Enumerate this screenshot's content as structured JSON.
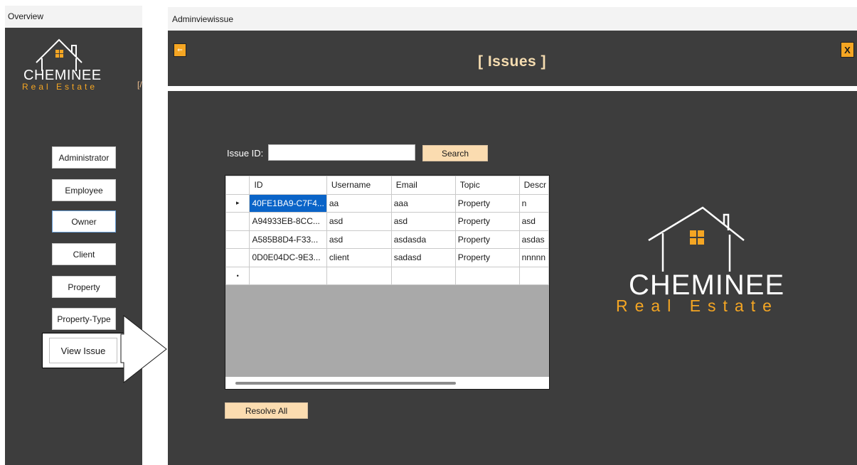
{
  "left_window": {
    "title": "Overview",
    "logo": {
      "brand": "CHEMINEE",
      "tagline": "Real Estate"
    },
    "clipped_text": "[/",
    "nav": [
      {
        "label": "Administrator"
      },
      {
        "label": "Employee"
      },
      {
        "label": "Owner"
      },
      {
        "label": "Client"
      },
      {
        "label": "Property"
      },
      {
        "label": "Property-Type"
      },
      {
        "label": "View Issue"
      }
    ]
  },
  "right_window": {
    "title": "Adminviewissue",
    "header": {
      "back_label": "⇐",
      "close_label": "X",
      "page_title": "[ Issues ]"
    },
    "search": {
      "label": "Issue ID:",
      "value": "",
      "button": "Search"
    },
    "grid": {
      "columns": [
        "ID",
        "Username",
        "Email",
        "Topic",
        "Descr"
      ],
      "rows": [
        [
          "40FE1BA9-C7F4...",
          "aa",
          "aaa",
          "Property",
          "n"
        ],
        [
          "A94933EB-8CC...",
          "asd",
          "asd",
          "Property",
          "asd"
        ],
        [
          "A585B8D4-F33...",
          "asd",
          "asdasda",
          "Property",
          "asdas"
        ],
        [
          "0D0E04DC-9E3...",
          "client",
          "sadasd",
          "Property",
          "nnnnn"
        ]
      ],
      "new_row_marker": "•",
      "current_row_marker": "▸"
    },
    "resolve_button": "Resolve All",
    "logo": {
      "brand": "CHEMINEE",
      "tagline": "Real Estate"
    }
  },
  "colors": {
    "panel": "#3d3d3d",
    "accent": "#f5a623",
    "button_peach": "#fbdcb0",
    "title_peach": "#f5dcb0",
    "selection": "#0a64c8"
  }
}
